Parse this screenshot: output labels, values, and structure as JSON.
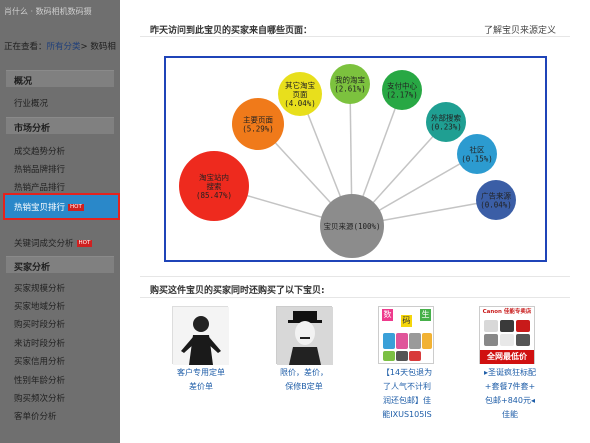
{
  "sidebar": {
    "top_crumb": "肖什么 · 数码相机数码摄",
    "view_label": "正在查看：",
    "view_link": "所有分类",
    "view_tail": "> 数码相",
    "sections": [
      {
        "label": "概况",
        "items": [
          "行业概况"
        ]
      },
      {
        "label": "市场分析",
        "items": [
          "成交趋势分析",
          "热销品牌排行",
          "热销产品排行",
          "热销宝贝排行",
          "关键词成交分析"
        ]
      },
      {
        "label": "买家分析",
        "items": [
          "买家规模分析",
          "买家地域分析",
          "购买时段分析",
          "来访时段分析",
          "买家信用分析",
          "性别年龄分析",
          "购买频次分析",
          "客单价分析"
        ]
      }
    ],
    "hot_badge": "HOT",
    "active_item": "热销宝贝排行"
  },
  "chart_panel": {
    "title": "昨天访问到此宝贝的买家来自哪些页面：",
    "help_link": "了解宝贝来源定义"
  },
  "chart_data": {
    "type": "diagram",
    "center": {
      "label": "宝贝来源",
      "value": "100%",
      "color": "#8c8c8c"
    },
    "nodes": [
      {
        "name": "淘宝站内搜索",
        "lines": [
          "淘宝站内",
          "搜索"
        ],
        "value": "85.47%",
        "color": "#ee2a1e"
      },
      {
        "name": "主要页面",
        "lines": [
          "主要页面"
        ],
        "value": "5.29%",
        "color": "#f07a1a"
      },
      {
        "name": "其它淘宝页面",
        "lines": [
          "其它淘宝",
          "页面"
        ],
        "value": "4.04%",
        "color": "#e8df1c"
      },
      {
        "name": "我的淘宝",
        "lines": [
          "我的淘宝"
        ],
        "value": "2.61%",
        "color": "#7cc23e"
      },
      {
        "name": "支付中心",
        "lines": [
          "支付中心"
        ],
        "value": "2.17%",
        "color": "#28a844"
      },
      {
        "name": "外部搜索",
        "lines": [
          "外部搜索"
        ],
        "value": "0.23%",
        "color": "#1f9f92"
      },
      {
        "name": "社区",
        "lines": [
          "社区"
        ],
        "value": "0.15%",
        "color": "#2c9bd0"
      },
      {
        "name": "广告来源",
        "lines": [
          "广告来源"
        ],
        "value": "0.04%",
        "color": "#3b5ea6"
      }
    ]
  },
  "products_panel": {
    "title": "购买这件宝贝的买家同时还购买了以下宝贝:",
    "products": [
      {
        "caption": [
          "客户专用定单",
          "差价单"
        ]
      },
      {
        "caption": [
          "限价，差价，",
          "保修B定单"
        ]
      },
      {
        "caption": [
          "【14天包退为",
          "了人气不计利",
          "润还包邮】佳",
          "能IXUS105IS"
        ]
      },
      {
        "caption": [
          "▸圣诞疯狂标配",
          "+套餐7件套+",
          "包邮+840元◂",
          "佳能"
        ]
      }
    ],
    "product3_chars": [
      "数",
      "码",
      "生"
    ],
    "product4_texts": [
      "Canon 佳能专卖店",
      "全网最低价"
    ]
  }
}
